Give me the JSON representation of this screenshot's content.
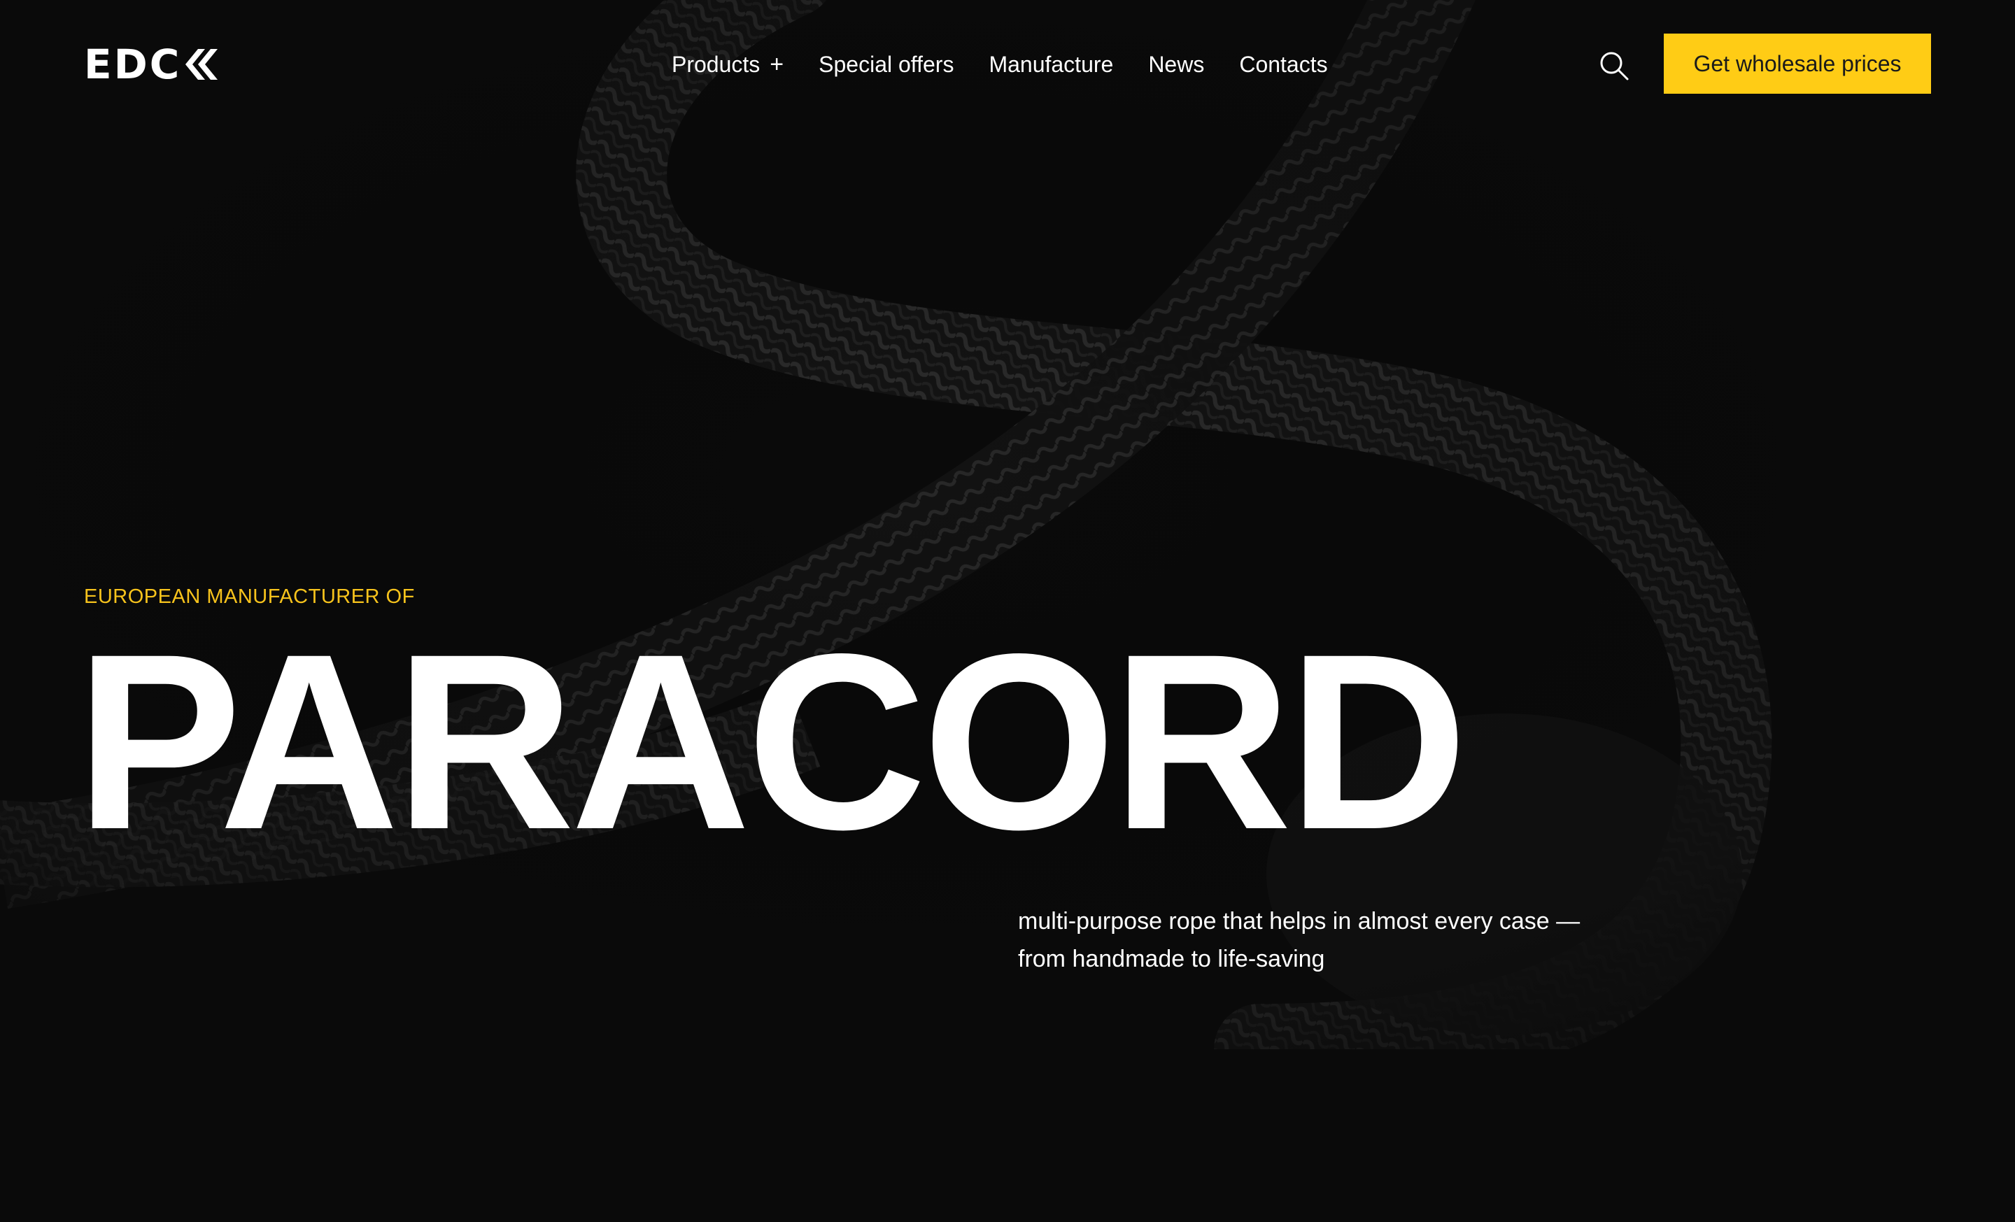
{
  "brand": {
    "logo_text": "EDC",
    "logo_icon": "double-chevron-left-icon"
  },
  "nav": {
    "items": [
      {
        "label": "Products",
        "has_submenu": true,
        "submenu_icon": "+"
      },
      {
        "label": "Special offers"
      },
      {
        "label": "Manufacture"
      },
      {
        "label": "News"
      },
      {
        "label": "Contacts"
      }
    ]
  },
  "header": {
    "search_icon": "search-icon",
    "cta_label": "Get wholesale prices"
  },
  "hero": {
    "eyebrow": "EUROPEAN MANUFACTURER OF",
    "title": "PARACORD",
    "description_line1": "multi-purpose rope that helps in almost every case —",
    "description_line2": "from handmade to life-saving"
  },
  "colors": {
    "background": "#0a0a0a",
    "accent": "#ffcc15",
    "eyebrow": "#f7c31c",
    "text": "#ffffff"
  }
}
